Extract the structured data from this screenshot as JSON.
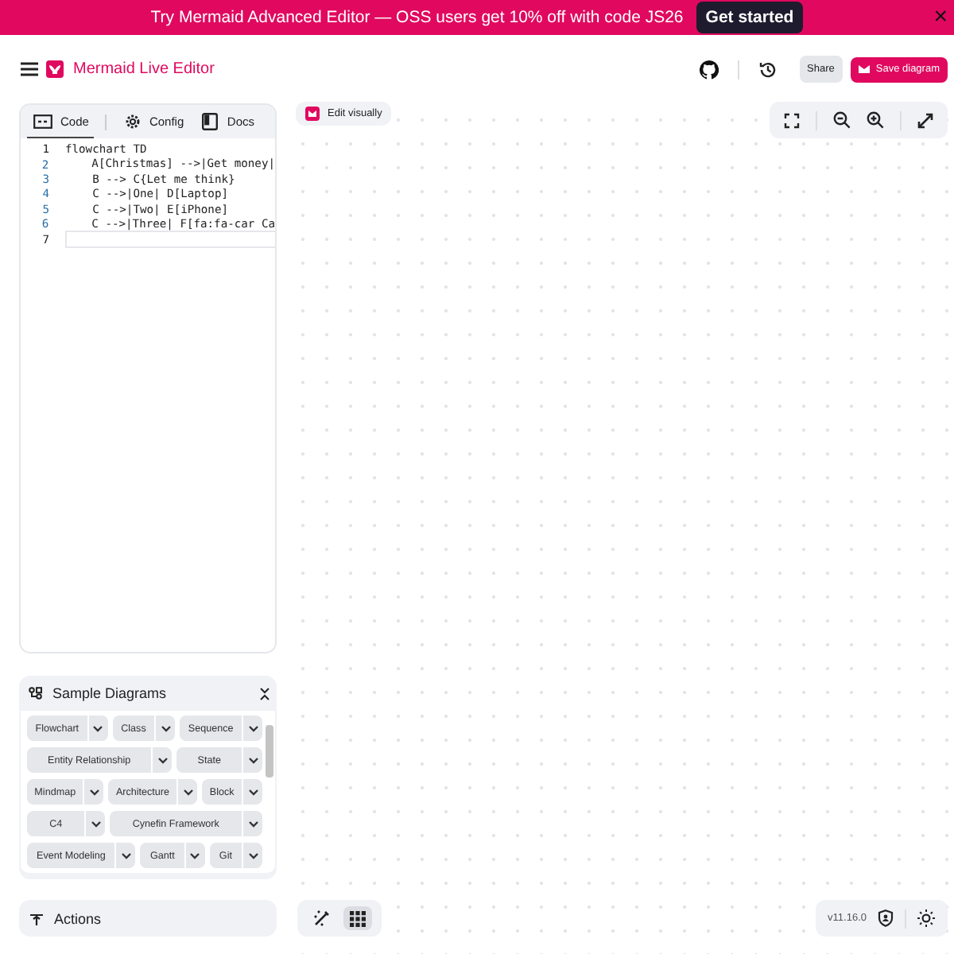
{
  "banner": {
    "message": "Try Mermaid Advanced Editor — OSS users get 10% off with code JS26",
    "button": "Get started",
    "close": "×"
  },
  "header": {
    "title": "Mermaid Live Editor",
    "share": "Share",
    "save": "Save diagram"
  },
  "editor": {
    "tabs": [
      {
        "label": "Code",
        "selected": true
      },
      {
        "label": "Config",
        "selected": false
      }
    ],
    "docs": "Docs",
    "lines": [
      {
        "number": "1",
        "text": "flowchart TD",
        "active": false
      },
      {
        "number": "2",
        "text": "    A[Christmas] -->|Get money|",
        "active": false
      },
      {
        "number": "3",
        "text": "    B --> C{Let me think}",
        "active": false
      },
      {
        "number": "4",
        "text": "    C -->|One| D[Laptop]",
        "active": false
      },
      {
        "number": "5",
        "text": "    C -->|Two| E[iPhone]",
        "active": false
      },
      {
        "number": "6",
        "text": "    C -->|Three| F[fa:fa-car Ca",
        "active": false
      },
      {
        "number": "7",
        "active": true
      }
    ]
  },
  "samples": {
    "title": "Sample Diagrams",
    "rows": [
      [
        "Flowchart",
        "Class",
        "Sequence"
      ],
      [
        "Entity Relationship",
        "State"
      ],
      [
        "Mindmap",
        "Architecture",
        "Block"
      ],
      [
        "C4",
        "Cynefin Framework"
      ],
      [
        "Event Modeling",
        "Gantt",
        "Git"
      ]
    ]
  },
  "actions": {
    "title": "Actions"
  },
  "canvas": {
    "edit_visually": "Edit visually",
    "view_modes": [
      {
        "kind": "pencil",
        "selected": false
      },
      {
        "kind": "grid",
        "selected": true
      }
    ],
    "version": "v11.16.0"
  }
}
